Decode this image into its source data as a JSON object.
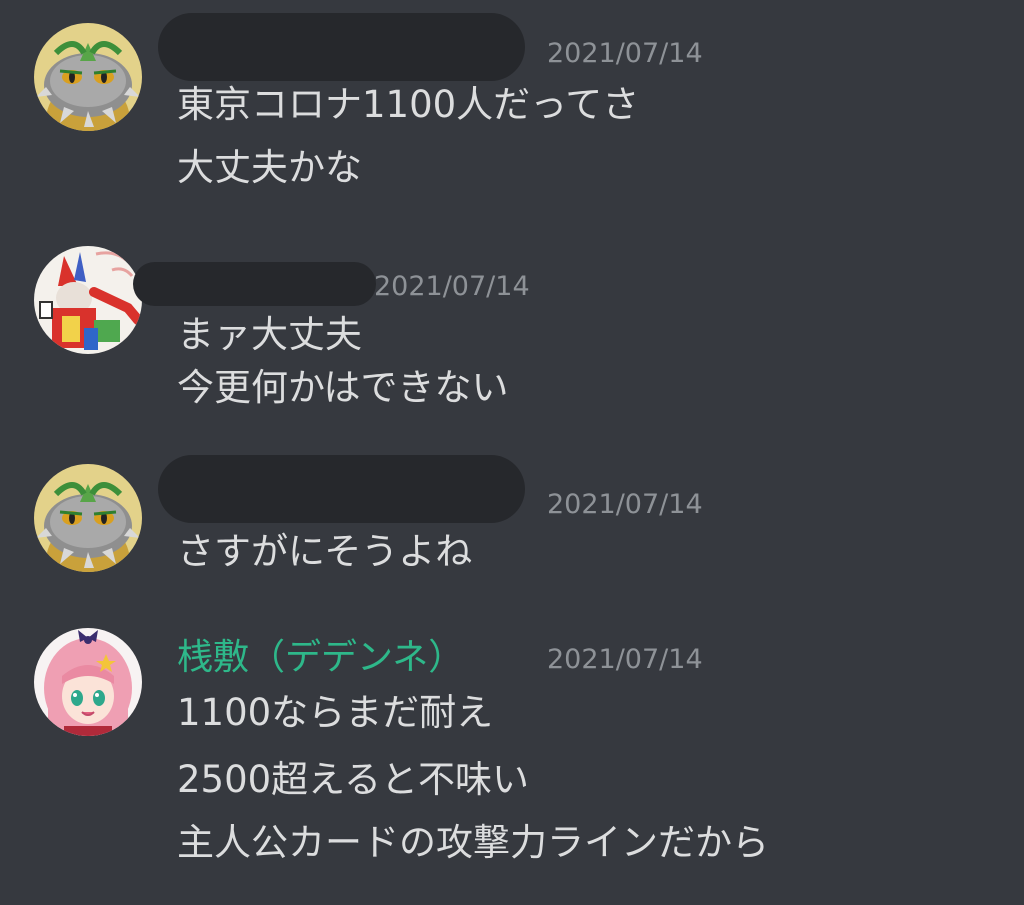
{
  "colors": {
    "background": "#36393f",
    "message_text": "#dcddde",
    "timestamp": "#8e9297",
    "redaction": "#26282c",
    "username_green": "#2eb88a"
  },
  "messages": [
    {
      "author": "",
      "author_redacted": true,
      "avatar_icon": "spiked-pokemon-avatar-icon",
      "timestamp": "2021/07/14",
      "lines": [
        "東京コロナ1100人だってさ",
        "大丈夫かな"
      ]
    },
    {
      "author": "",
      "author_redacted": true,
      "avatar_icon": "red-character-avatar-icon",
      "timestamp": "2021/07/14",
      "lines": [
        "まァ大丈夫",
        "今更何かはできない"
      ]
    },
    {
      "author": "",
      "author_redacted": true,
      "avatar_icon": "spiked-pokemon-avatar-icon",
      "timestamp": "2021/07/14",
      "lines": [
        "さすがにそうよね"
      ]
    },
    {
      "author": "桟敷（デデンネ）",
      "author_redacted": false,
      "avatar_icon": "pink-hair-anime-girl-avatar-icon",
      "timestamp": "2021/07/14",
      "lines": [
        "1100ならまだ耐え",
        "2500超えると不味い",
        "主人公カードの攻撃力ラインだから"
      ]
    }
  ]
}
